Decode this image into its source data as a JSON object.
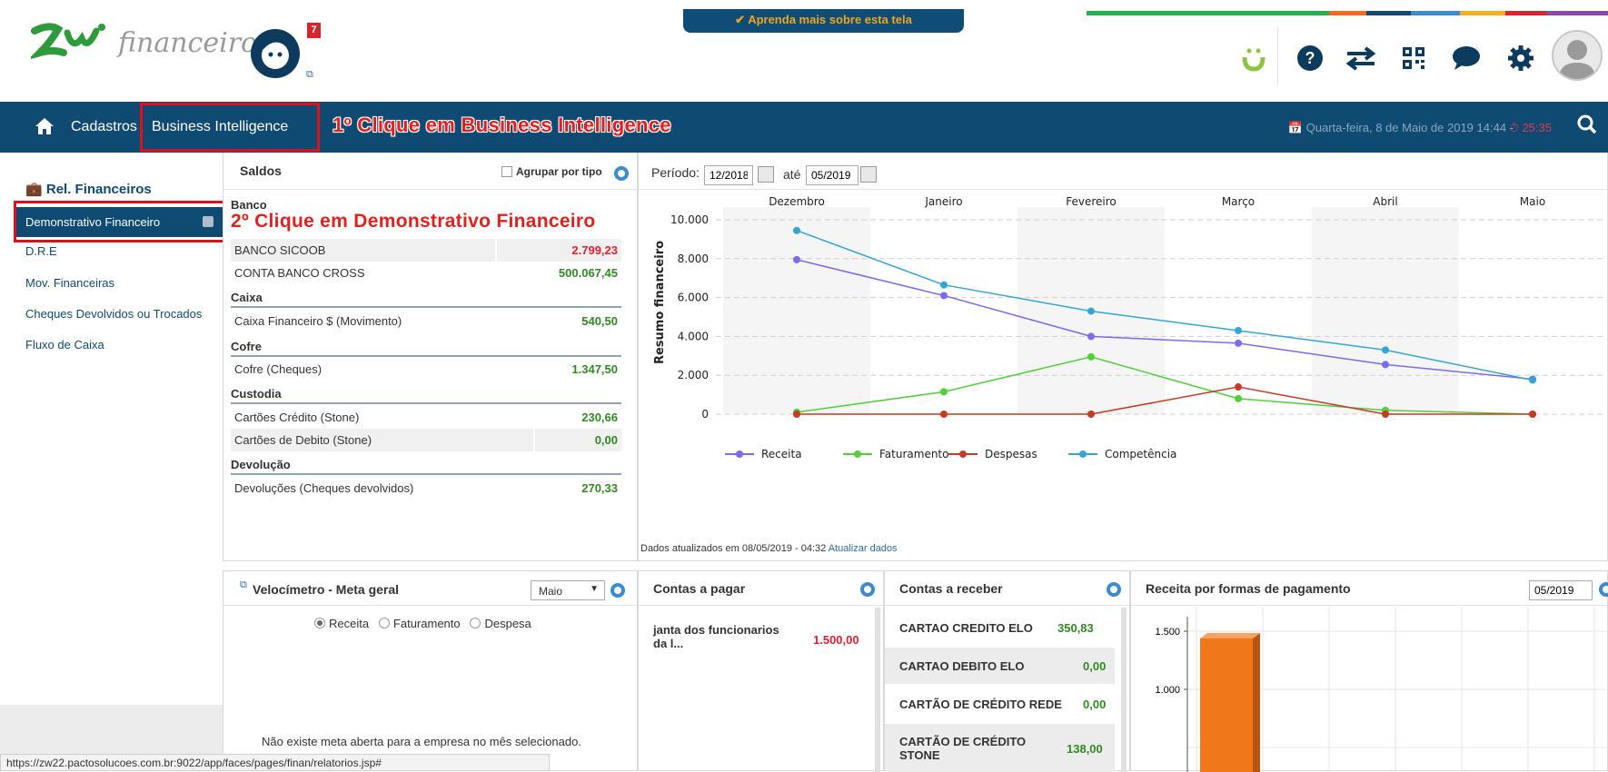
{
  "header": {
    "logo_text": "financeiro",
    "notification_count": "7",
    "learn_more": "✔ Aprenda mais sobre esta tela",
    "stripe_colors": [
      "#23b24b",
      "#f26b21",
      "#0f4a72",
      "#3a8bd0",
      "#f3b11c",
      "#d9232d",
      "#8e44ad"
    ],
    "icons": [
      "pacto-icon",
      "help-icon",
      "switch-icon",
      "qrcode-icon",
      "chat-icon",
      "gear-icon",
      "user-avatar"
    ]
  },
  "navbar": {
    "cadastros": "Cadastros",
    "business_intelligence": "Business Intelligence",
    "callout_1": "1º Clique em Business Intelligence",
    "date": "📅 Quarta-feira, 8 de Maio de 2019 14:44  -",
    "timer": "⏱ 25:35"
  },
  "sidebar": {
    "title": "Rel. Financeiros",
    "items": [
      "Demonstrativo Financeiro",
      "D.R.E",
      "Mov. Financeiras",
      "Cheques Devolvidos ou Trocados",
      "Fluxo de Caixa"
    ],
    "callout_2": "2º Clique em Demonstrativo Financeiro"
  },
  "saldos": {
    "title": "Saldos",
    "agrupar": "Agrupar por tipo",
    "groups": {
      "banco": "Banco",
      "caixa": "Caixa",
      "cofre": "Cofre",
      "custodia": "Custodia",
      "devolucao": "Devolução"
    },
    "rows": [
      {
        "label": "BANCO SICOOB",
        "value": "2.799,23",
        "color": "#e3212d"
      },
      {
        "label": "CONTA BANCO CROSS",
        "value": "500.067,45",
        "color": "#2e8b1f"
      },
      {
        "label": "Caixa Financeiro $ (Movimento)",
        "value": "540,50",
        "color": "#2e8b1f"
      },
      {
        "label": "Cofre (Cheques)",
        "value": "1.347,50",
        "color": "#2e8b1f"
      },
      {
        "label": "Cartões Crédito (Stone)",
        "value": "230,66",
        "color": "#2e8b1f"
      },
      {
        "label": "Cartões de Debito (Stone)",
        "value": "0,00",
        "color": "#2e8b1f"
      },
      {
        "label": "Devoluções (Cheques devolvidos)",
        "value": "270,33",
        "color": "#2e8b1f"
      }
    ]
  },
  "periodo": {
    "label": "Período:",
    "start": "12/2018",
    "ate": "até",
    "end": "05/2019",
    "updated": "Dados atualizados em 08/05/2019 - 04:32",
    "update_link": "Atualizar dados"
  },
  "chart_data": {
    "type": "line",
    "categories": [
      "Dezembro",
      "Janeiro",
      "Fevereiro",
      "Março",
      "Abril",
      "Maio"
    ],
    "ylabel": "Resumo financeiro",
    "ylim": [
      0,
      10000
    ],
    "yticks": [
      "0",
      "2.000",
      "4.000",
      "6.000",
      "8.000",
      "10.000"
    ],
    "series": [
      {
        "name": "Receita",
        "color": "#7b6af2",
        "values": [
          7950,
          6100,
          4000,
          3650,
          2550,
          1800
        ]
      },
      {
        "name": "Faturamento",
        "color": "#4fd13a",
        "values": [
          100,
          1150,
          2950,
          800,
          200,
          0
        ]
      },
      {
        "name": "Despesas",
        "color": "#c73a24",
        "values": [
          0,
          0,
          0,
          1400,
          0,
          0
        ]
      },
      {
        "name": "Competência",
        "color": "#32a6d6",
        "values": [
          9450,
          6650,
          5300,
          4300,
          3300,
          1750
        ]
      }
    ],
    "legend_position": "bottom"
  },
  "velocimetro": {
    "title": "Velocímetro - Meta geral",
    "month": "Maio",
    "options": [
      "Receita",
      "Faturamento",
      "Despesa"
    ],
    "message": "Não existe meta aberta para a empresa no mês selecionado."
  },
  "contas_pagar": {
    "title": "Contas a pagar",
    "items": [
      {
        "label": "janta dos funcionarios da l...",
        "value": "1.500,00"
      }
    ]
  },
  "contas_receber": {
    "title": "Contas a receber",
    "items": [
      {
        "label": "CARTAO CREDITO ELO",
        "value": "350,83"
      },
      {
        "label": "CARTAO DEBITO ELO",
        "value": "0,00"
      },
      {
        "label": "CARTÃO DE CRÉDITO REDE",
        "value": "0,00"
      },
      {
        "label": "CARTÃO DE CRÉDITO STONE",
        "value": "138,00"
      }
    ]
  },
  "receita_formas": {
    "title": "Receita por formas de pagamento",
    "month": "05/2019",
    "yticks": [
      "1.500",
      "1.000"
    ]
  },
  "status_url": "https://zw22.pactosolucoes.com.br:9022/app/faces/pages/finan/relatorios.jsp#"
}
